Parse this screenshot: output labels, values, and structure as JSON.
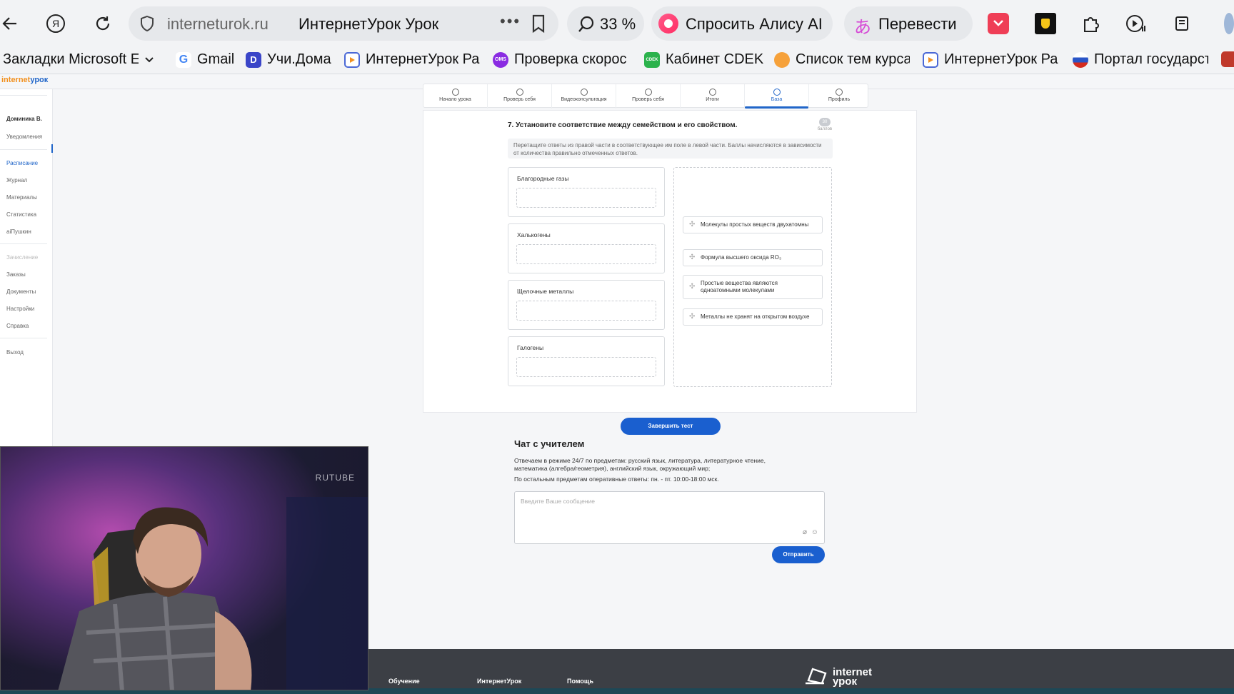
{
  "browser": {
    "domain": "interneturok.ru",
    "tab_title": "ИнтернетУрок Урок",
    "zoom": "33 %",
    "alice_label": "Спросить Алису AI",
    "translate_label": "Перевести",
    "bookmarks": [
      {
        "label": "Закладки Microsoft E",
        "icon": "folder-icon"
      },
      {
        "label": "Gmail",
        "icon": "google-icon"
      },
      {
        "label": "Учи.Дома",
        "icon": "uchi-icon"
      },
      {
        "label": "ИнтернетУрок Ра",
        "icon": "play-icon"
      },
      {
        "label": "Проверка скорос",
        "icon": "speedtest-icon"
      },
      {
        "label": "Кабинет CDEK",
        "icon": "cdek-icon"
      },
      {
        "label": "Список тем курса",
        "icon": "course-icon"
      },
      {
        "label": "ИнтернетУрок Ра",
        "icon": "play-icon"
      },
      {
        "label": "Портал государст",
        "icon": "gosuslugi-icon"
      }
    ],
    "fav_texts": {
      "gmail": "G",
      "uchi": "D",
      "speed": "OMS",
      "cdek": "CDEK"
    }
  },
  "site": {
    "logo_a": "internet",
    "logo_b": "урок",
    "sidebar": {
      "user": "Доминика В.",
      "notifications": "Уведомления",
      "schedule": "Расписание",
      "journal": "Журнал",
      "materials": "Материалы",
      "statistics": "Статистика",
      "aipushkin": "аiПушкин",
      "enrollment": "Зачисление",
      "orders": "Заказы",
      "documents": "Документы",
      "settings": "Настройки",
      "help": "Справка",
      "logout": "Выход"
    },
    "steps": [
      "Начало урока",
      "Проверь себя",
      "Видеоконсультация",
      "Проверь себя",
      "Итоги",
      "База",
      "Профиль"
    ],
    "question": {
      "title": "7. Установите соответствие между семейством и его свойством.",
      "score_value": "30",
      "score_label": "баллов",
      "hint": "Перетащите ответы из правой части в соответствующее им поле в левой части. Баллы начисляются в зависимости от количества правильно отмеченных ответов.",
      "targets": [
        "Благородные газы",
        "Халькогены",
        "Щелочные металлы",
        "Галогены"
      ],
      "answers": [
        "Молекулы простых веществ двухатомны",
        "Формула высшего оксида RO₃",
        "Простые вещества являются одноатомными молекулами",
        "Металлы не хранят на открытом воздухе"
      ],
      "finish_label": "Завершить тест"
    },
    "chat": {
      "title": "Чат с учителем",
      "text1": "Отвечаем в режиме 24/7 по предметам: русский язык, литература, литературное чтение, математика (алгебра/геометрия), английский язык, окружающий мир;",
      "text2": "По остальным предметам оперативные ответы: пн. - пт. 10:00-18:00 мск.",
      "placeholder": "Введите Ваше сообщение",
      "send_label": "Отправить"
    },
    "footer": {
      "col1": "Обучение",
      "col2": "ИнтернетУрок",
      "col3": "Помощь",
      "logo_line1": "internet",
      "logo_line2": "урок"
    }
  },
  "video": {
    "watermark": "RUTUBE"
  }
}
